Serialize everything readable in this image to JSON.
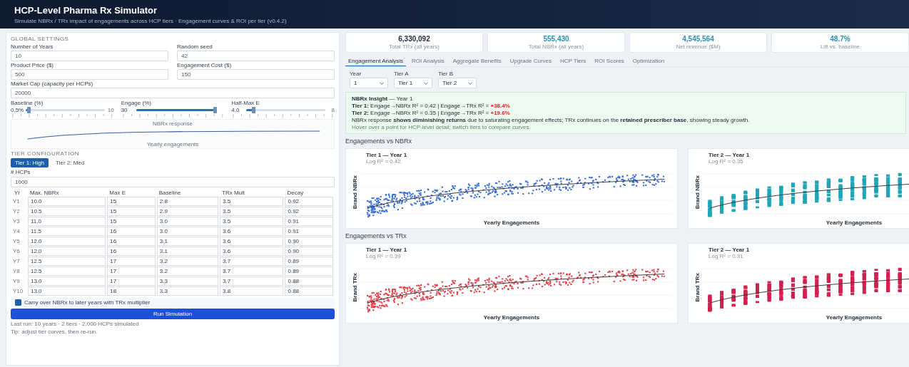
{
  "header": {
    "title": "HCP-Level Pharma Rx Simulator",
    "subtitle": "Simulate NBRx / TRx impact of engagements across HCP tiers · Engagement curves & ROI per tier (v0.4.2)"
  },
  "settings": {
    "title": "GLOBAL SETTINGS",
    "fields": [
      {
        "label": "Number of Years",
        "value": "10"
      },
      {
        "label": "Random seed",
        "value": "42"
      },
      {
        "label": "Product Price ($)",
        "value": "500"
      },
      {
        "label": "Engagement Cost ($)",
        "value": "150"
      },
      {
        "label": "Market Cap (capacity per HCPs)",
        "value": "20000"
      }
    ],
    "sliders": [
      {
        "label": "Baseline (%)",
        "reading": "0.5%",
        "end": "10",
        "level": 0.04
      },
      {
        "label": "Engage (%)",
        "reading": "30",
        "level": 1.0
      },
      {
        "label": "Half-Max E",
        "reading": "4.0",
        "end": "8",
        "level": 0.09
      }
    ],
    "curve": {
      "title": "NBRx response",
      "x_label": "Yearly engagements"
    }
  },
  "tiers": {
    "title": "TIER CONFIGURATION",
    "tabs": [
      {
        "label": "Tier 1: High",
        "selected": true
      },
      {
        "label": "Tier 2: Med",
        "selected": false
      }
    ],
    "count_label": "# HCPs",
    "count_value": "1000",
    "columns": [
      "Yr",
      "Max. NBRx",
      "Max E",
      "Baseline",
      "TRx Mult",
      "Decay"
    ],
    "rows": [
      [
        "Y1",
        "10.0",
        "15",
        "2.8",
        "3.5",
        "0.92"
      ],
      [
        "Y2",
        "10.5",
        "15",
        "2.9",
        "3.5",
        "0.92"
      ],
      [
        "Y3",
        "11.0",
        "15",
        "3.0",
        "3.5",
        "0.91"
      ],
      [
        "Y4",
        "11.5",
        "16",
        "3.0",
        "3.6",
        "0.91"
      ],
      [
        "Y5",
        "12.0",
        "16",
        "3.1",
        "3.6",
        "0.90"
      ],
      [
        "Y6",
        "12.0",
        "16",
        "3.1",
        "3.6",
        "0.90"
      ],
      [
        "Y7",
        "12.5",
        "17",
        "3.2",
        "3.7",
        "0.89"
      ],
      [
        "Y8",
        "12.5",
        "17",
        "3.2",
        "3.7",
        "0.89"
      ],
      [
        "Y9",
        "13.0",
        "17",
        "3.3",
        "3.7",
        "0.88"
      ],
      [
        "Y10",
        "13.0",
        "18",
        "3.3",
        "3.8",
        "0.88"
      ]
    ],
    "carry": {
      "label": "Carry over NBRx to later years with TRx multiplier",
      "checked": true
    },
    "run_button": "Run Simulation",
    "notes": [
      "Last run: 10 years · 2 tiers · 2,000 HCPs simulated",
      "Tip: adjust tier curves, then re-run."
    ]
  },
  "kpis": [
    {
      "value": "6,330,092",
      "label": "Total TRx (all years)",
      "color": "#1f2937"
    },
    {
      "value": "555,430",
      "label": "Total NBRx (all years)",
      "color": "#2a8fb8"
    },
    {
      "value": "4,545,564",
      "label": "Net revenue ($M)",
      "color": "#2a8fb8"
    },
    {
      "value": "48.7%",
      "label": "Lift vs. baseline",
      "color": "#2a8fb8"
    }
  ],
  "tabs": [
    {
      "label": "Engagement Analysis",
      "selected": true
    },
    {
      "label": "ROI Analysis",
      "selected": false
    },
    {
      "label": "Aggregate Benefits",
      "selected": false
    },
    {
      "label": "Upgrade Curves",
      "selected": false
    },
    {
      "label": "HCP Tiers",
      "selected": false
    },
    {
      "label": "ROI Scores",
      "selected": false
    },
    {
      "label": "Optimization",
      "selected": false
    }
  ],
  "filters": [
    {
      "label": "Year",
      "value": "1"
    },
    {
      "label": "Tier A",
      "value": "Tier 1"
    },
    {
      "label": "Tier B",
      "value": "Tier 2"
    }
  ],
  "insight": {
    "heading": "**NBRx Insight** — Year 1",
    "lines": [
      {
        "text": "**Tier 1:** Engage→NBRx R² = 0.42 | Engage→TRx R² = ",
        "delta": "+38.4%"
      },
      {
        "text": "**Tier 2:** Engage→NBRx R² = 0.35 | Engage→TRx R² = ",
        "delta": "+19.6%"
      }
    ],
    "summary": "NBRx response **shows diminishing returns** due to saturating engagement effects; TRx continues on the **retained prescriber base**, showing steady growth.",
    "note": "Hover over a point for HCP-level detail; switch tiers to compare curves."
  },
  "sections": [
    {
      "title": "Engagements vs NBRx",
      "charts": [
        {
          "title": "Tier 1 — Year 1",
          "subtitle": "Log R² = 0.42",
          "y_label": "Brand NBRx",
          "x_label": "Yearly Engagements",
          "color": "#3b6fd8",
          "kind": "spread"
        },
        {
          "title": "Tier 2 — Year 1",
          "subtitle": "Log R² = 0.35",
          "y_label": "Brand NBRx",
          "x_label": "Yearly Engagements",
          "color": "#1fa6b8",
          "kind": "columns"
        }
      ]
    },
    {
      "title": "Engagements vs TRx",
      "charts": [
        {
          "title": "Tier 1 — Year 1",
          "subtitle": "Log R² = 0.39",
          "y_label": "Brand TRx",
          "x_label": "Yearly Engagements",
          "color": "#e0424a",
          "kind": "spread"
        },
        {
          "title": "Tier 2 — Year 1",
          "subtitle": "Log R² = 0.31",
          "y_label": "Brand TRx",
          "x_label": "Yearly Engagements",
          "color": "#d4204f",
          "kind": "columns"
        }
      ]
    }
  ]
}
